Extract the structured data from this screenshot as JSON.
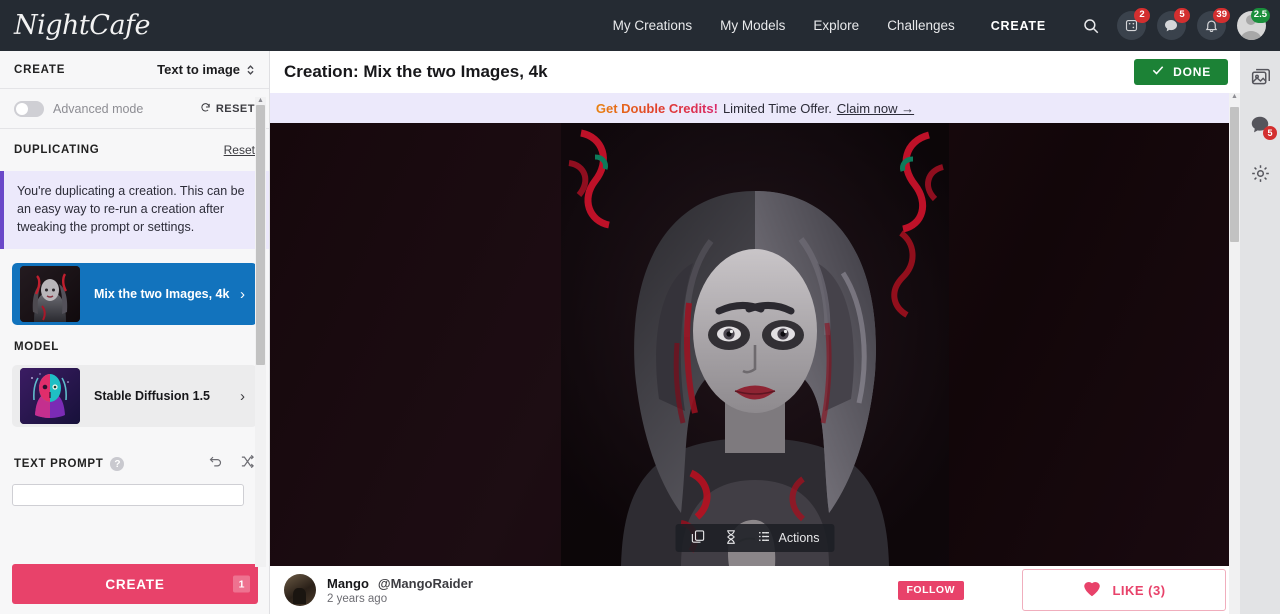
{
  "brand": {
    "logo_text": "NightCafe"
  },
  "topnav": {
    "links": [
      {
        "label": "My Creations",
        "name": "nav-my-creations"
      },
      {
        "label": "My Models",
        "name": "nav-my-models"
      },
      {
        "label": "Explore",
        "name": "nav-explore"
      },
      {
        "label": "Challenges",
        "name": "nav-challenges"
      }
    ],
    "create_label": "CREATE",
    "search_icon": "search-icon",
    "icons": [
      {
        "name": "dice-icon",
        "badge": "2"
      },
      {
        "name": "chat-bubble-icon",
        "badge": "5"
      },
      {
        "name": "bell-icon",
        "badge": "39"
      }
    ],
    "avatar": {
      "name": "user-avatar",
      "credits_badge": "2.5"
    }
  },
  "sidebar": {
    "header_title": "CREATE",
    "mode": "Text to image",
    "advanced_mode_label": "Advanced mode",
    "advanced_mode_on": false,
    "reset_label": "RESET",
    "duplicating_title": "DUPLICATING",
    "duplicating_reset": "Reset",
    "info_text": "You're duplicating a creation. This can be an easy way to re-run a creation after tweaking the prompt or settings.",
    "creation_card_title": "Mix the two Images, 4k",
    "model_section_label": "MODEL",
    "model_name": "Stable Diffusion 1.5",
    "prompt_label": "TEXT PROMPT",
    "prompt_help": "?",
    "prompt_value": "",
    "prompt_placeholder": "",
    "create_button": "CREATE",
    "create_count": "1"
  },
  "main": {
    "title": "Creation: Mix the two Images, 4k",
    "done_label": "DONE",
    "banner": {
      "strong": "Get Double Credits!",
      "rest": "Limited Time Offer.",
      "link": "Claim now →"
    },
    "actions": {
      "copy_icon": "copy-icon",
      "evolve_icon": "hourglass-icon",
      "actions_label": "Actions"
    },
    "footer": {
      "user_name": "Mango",
      "user_handle": "@MangoRaider",
      "time_ago": "2 years ago",
      "follow_label": "FOLLOW",
      "like_label": "LIKE (3)"
    }
  },
  "rail": {
    "items": [
      {
        "name": "gallery-icon",
        "badge": ""
      },
      {
        "name": "chat-bubble-icon",
        "badge": "5"
      },
      {
        "name": "gear-icon",
        "badge": ""
      }
    ]
  },
  "colors": {
    "nav_bg": "#252b33",
    "accent_pink": "#e8426a",
    "accent_blue": "#1273bd",
    "done_green": "#1c8236",
    "banner_bg": "#ece9fb",
    "badge_red": "#d32f2f",
    "badge_green": "#1a8f3c"
  }
}
